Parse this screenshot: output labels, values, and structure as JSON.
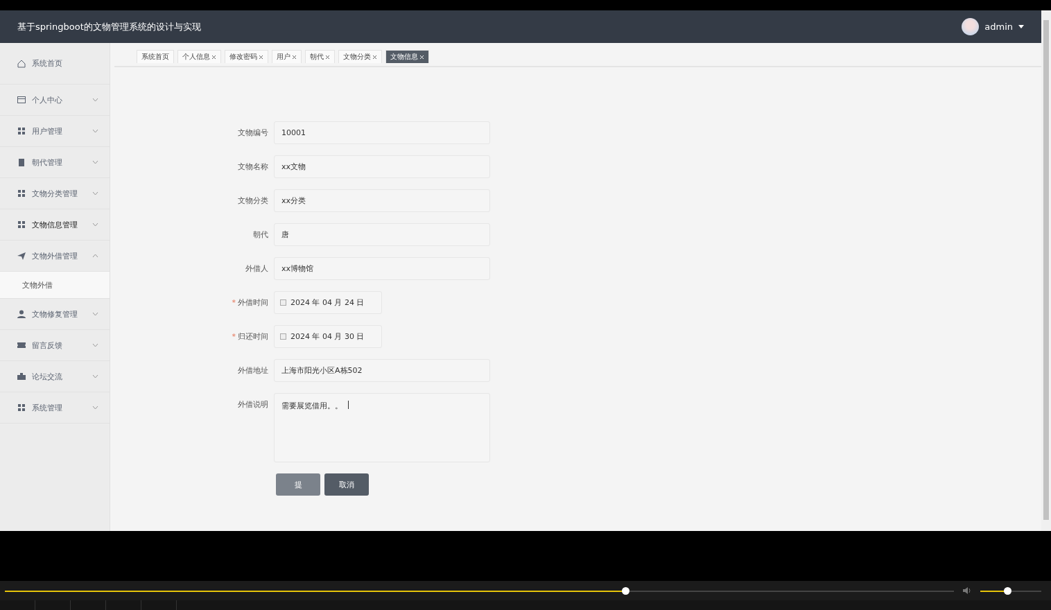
{
  "header": {
    "title": "基于springboot的文物管理系统的设计与实现",
    "user": "admin"
  },
  "tabs": [
    {
      "label": "系统首页",
      "closable": false,
      "selected": false
    },
    {
      "label": "个人信息",
      "closable": true,
      "selected": false
    },
    {
      "label": "修改密码",
      "closable": true,
      "selected": false
    },
    {
      "label": "用户",
      "closable": true,
      "selected": false
    },
    {
      "label": "朝代",
      "closable": true,
      "selected": false
    },
    {
      "label": "文物分类",
      "closable": true,
      "selected": false
    },
    {
      "label": "文物信息",
      "closable": true,
      "selected": true
    }
  ],
  "sidebar": {
    "items": [
      {
        "label": "系统首页",
        "kind": "home",
        "active": false
      },
      {
        "label": "个人中心",
        "kind": "card",
        "expandable": true,
        "expanded": false,
        "active": false
      },
      {
        "label": "用户管理",
        "kind": "grid",
        "expandable": true,
        "expanded": false,
        "active": false
      },
      {
        "label": "朝代管理",
        "kind": "clipboard",
        "expandable": true,
        "expanded": false,
        "active": false
      },
      {
        "label": "文物分类管理",
        "kind": "grid",
        "expandable": true,
        "expanded": false,
        "active": false
      },
      {
        "label": "文物信息管理",
        "kind": "grid",
        "expandable": true,
        "expanded": false,
        "active": true
      },
      {
        "label": "文物外借管理",
        "kind": "plane",
        "expandable": true,
        "expanded": true,
        "active": false,
        "children": [
          {
            "label": "文物外借"
          }
        ]
      },
      {
        "label": "文物修复管理",
        "kind": "user",
        "expandable": true,
        "expanded": false,
        "active": false
      },
      {
        "label": "留言反馈",
        "kind": "ticket",
        "expandable": true,
        "expanded": false,
        "active": false
      },
      {
        "label": "论坛交流",
        "kind": "briefcase",
        "expandable": true,
        "expanded": false,
        "active": false
      },
      {
        "label": "系统管理",
        "kind": "grid",
        "expandable": true,
        "expanded": false,
        "active": false
      }
    ]
  },
  "form": {
    "fields": [
      {
        "label": "文物编号",
        "kind": "text",
        "value": "10001"
      },
      {
        "label": "文物名称",
        "kind": "text",
        "value": "xx文物"
      },
      {
        "label": "文物分类",
        "kind": "text",
        "value": "xx分类"
      },
      {
        "label": "朝代",
        "kind": "text",
        "value": "唐"
      },
      {
        "label": "外借人",
        "kind": "text",
        "value": "xx博物馆"
      },
      {
        "label": "外借时间",
        "kind": "date",
        "required_mark": "*",
        "value": "2024 年 04 月 24 日"
      },
      {
        "label": "归还时间",
        "kind": "date",
        "required_mark": "*",
        "value": "2024 年 04 月 30 日"
      },
      {
        "label": "外借地址",
        "kind": "text",
        "value": "上海市阳光小区A栋502"
      },
      {
        "label": "外借说明",
        "kind": "textarea",
        "value": "需要展览借用。。"
      }
    ],
    "buttons": [
      {
        "label": "提",
        "kind": "submit"
      },
      {
        "label": "取消",
        "kind": "cancel"
      }
    ]
  },
  "player": {
    "progress": {
      "level": 0.654
    },
    "volume": {
      "level": 0.44
    }
  }
}
